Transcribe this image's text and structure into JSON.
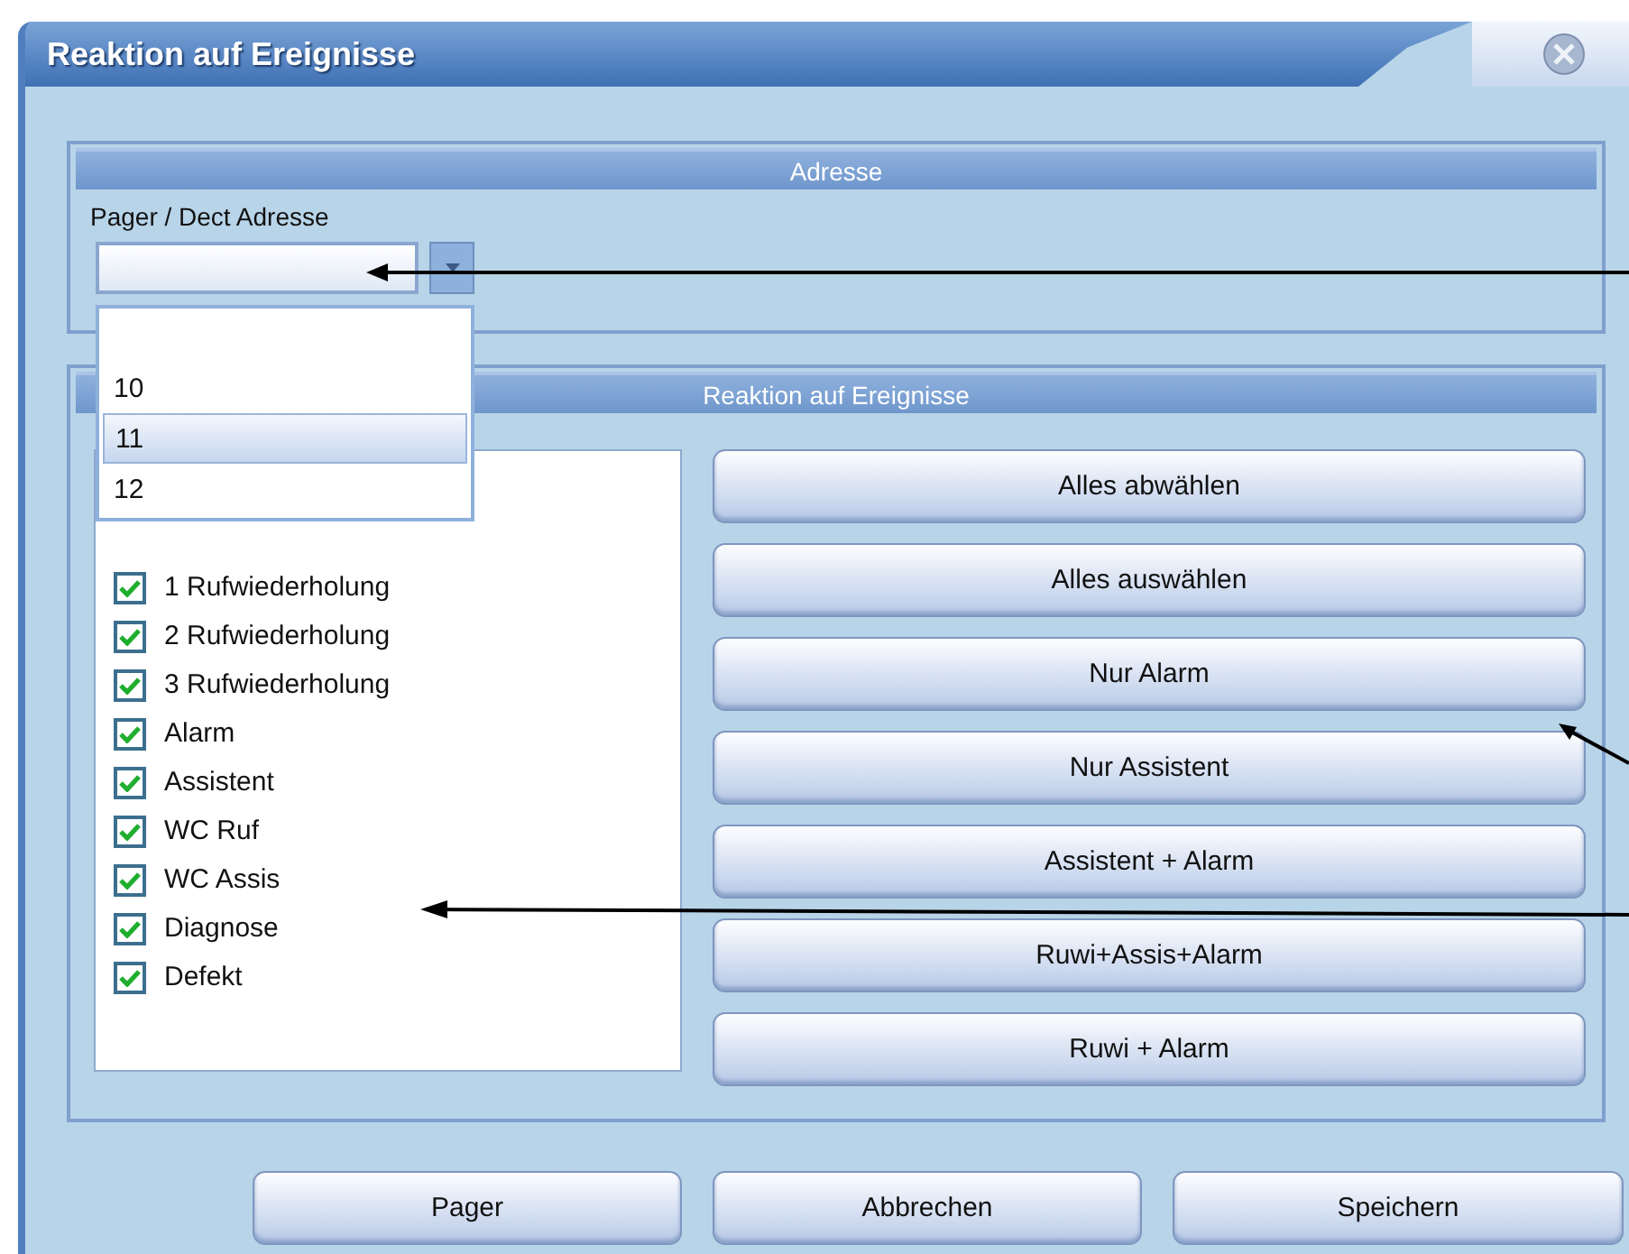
{
  "window": {
    "title": "Reaktion auf Ereignisse"
  },
  "address_group": {
    "header": "Adresse",
    "label": "Pager / Dect Adresse",
    "dropdown": {
      "options": [
        {
          "label": "10",
          "selected": false
        },
        {
          "label": "11",
          "selected": true
        },
        {
          "label": "12",
          "selected": false
        }
      ]
    }
  },
  "events_group": {
    "header": "Reaktion auf Ereignisse",
    "events": [
      {
        "label": "1 Rufwiederholung",
        "checked": true
      },
      {
        "label": "2 Rufwiederholung",
        "checked": true
      },
      {
        "label": "3 Rufwiederholung",
        "checked": true
      },
      {
        "label": "Alarm",
        "checked": true
      },
      {
        "label": "Assistent",
        "checked": true
      },
      {
        "label": "WC Ruf",
        "checked": true
      },
      {
        "label": "WC Assis",
        "checked": true
      },
      {
        "label": "Diagnose",
        "checked": true
      },
      {
        "label": "Defekt",
        "checked": true
      }
    ],
    "actions": [
      "Alles abwählen",
      "Alles auswählen",
      "Nur Alarm",
      "Nur Assistent",
      "Assistent + Alarm",
      "Ruwi+Assis+Alarm",
      "Ruwi + Alarm"
    ]
  },
  "buttons": [
    "Pager",
    "Abbrechen",
    "Speichern"
  ]
}
